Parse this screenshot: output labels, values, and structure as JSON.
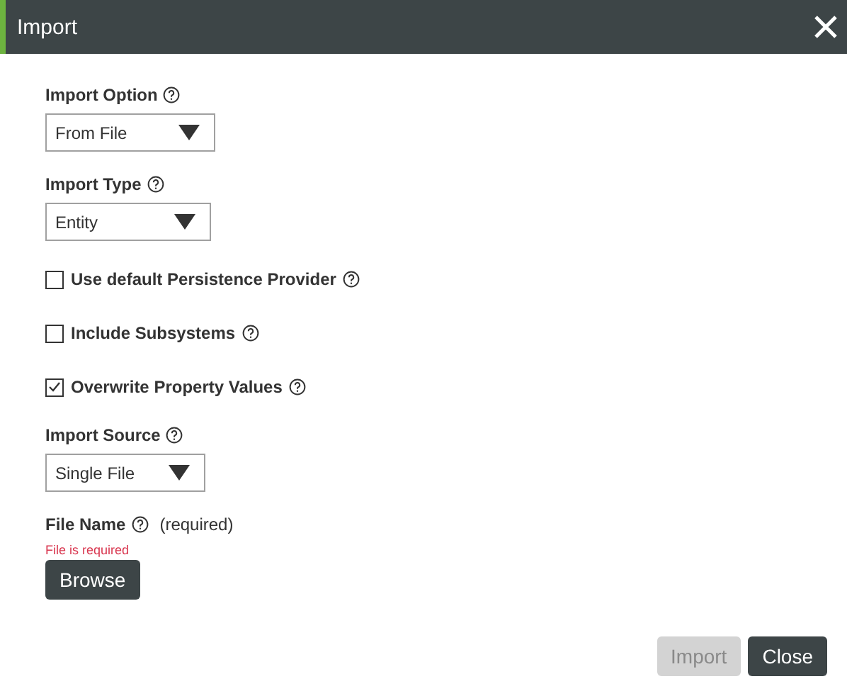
{
  "window": {
    "title": "Import"
  },
  "fields": [
    {
      "kind": "select",
      "label": "Import Option",
      "value": "From File"
    },
    {
      "kind": "select",
      "label": "Import Type",
      "value": "Entity"
    },
    {
      "kind": "checkbox",
      "label": "Use default Persistence Provider",
      "checked": false
    },
    {
      "kind": "checkbox",
      "label": "Include Subsystems",
      "checked": false
    },
    {
      "kind": "checkbox",
      "label": "Overwrite Property Values",
      "checked": true
    },
    {
      "kind": "select",
      "label": "Import Source",
      "value": "Single File"
    },
    {
      "kind": "file",
      "label": "File Name",
      "note": "(required)",
      "error": "File is required",
      "button": "Browse"
    }
  ],
  "buttons": [
    {
      "label": "Import",
      "disabled": true
    },
    {
      "label": "Close",
      "disabled": false
    }
  ]
}
